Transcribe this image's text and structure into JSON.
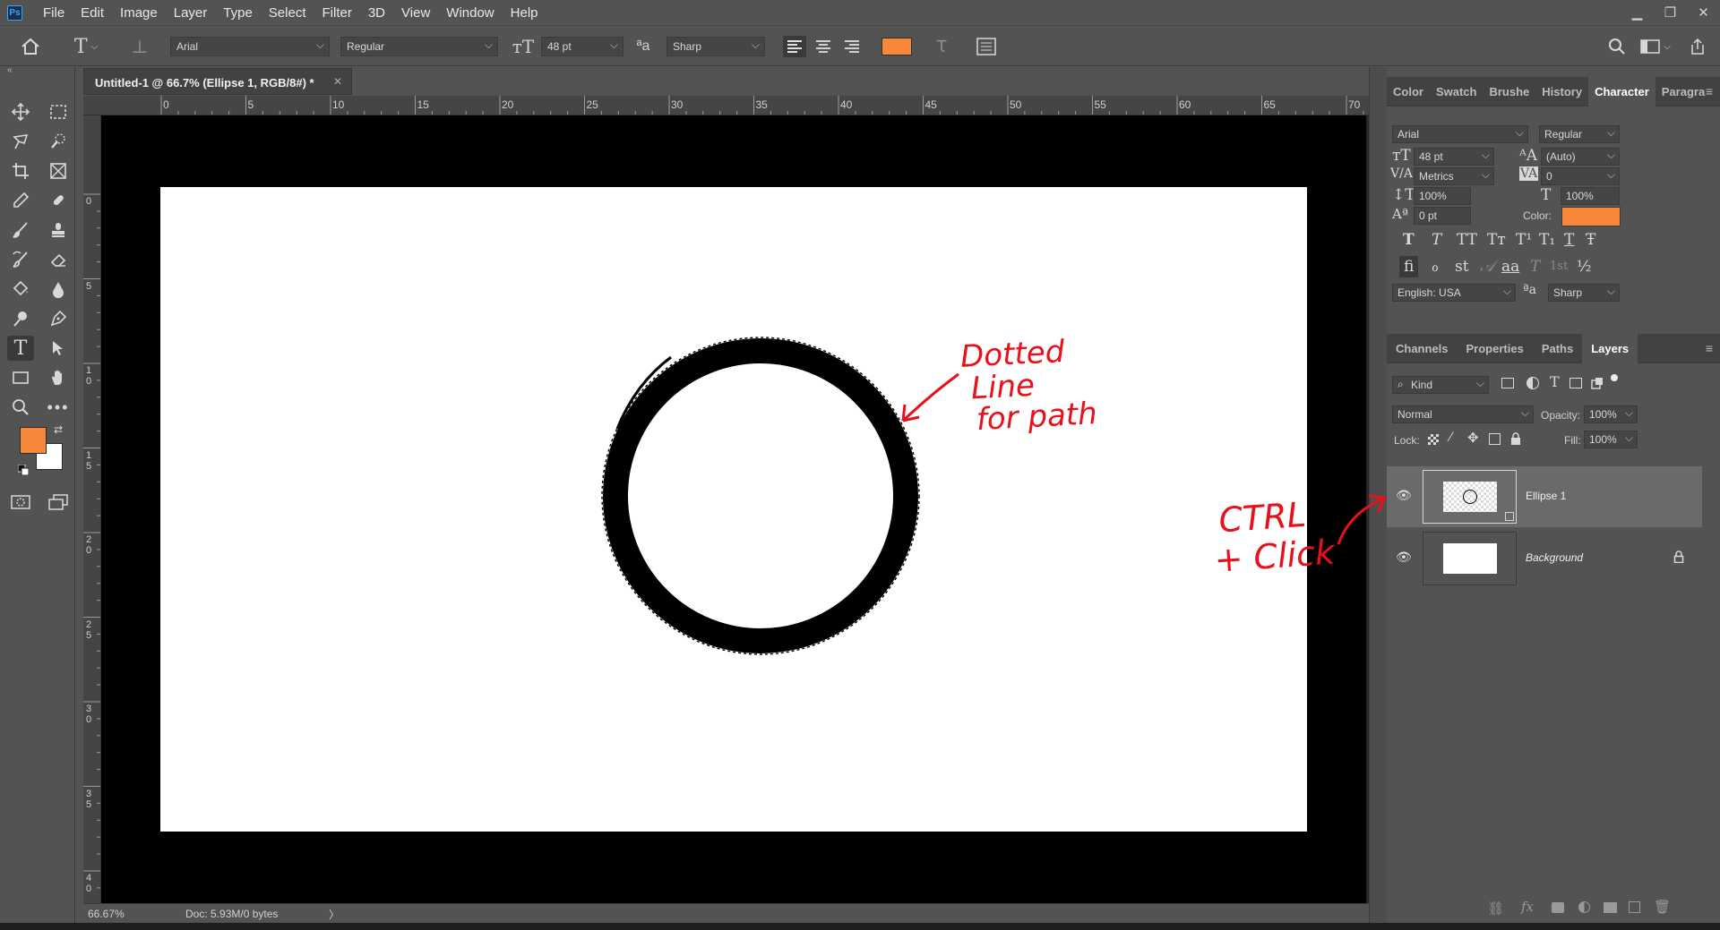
{
  "app": {
    "logo": "Ps"
  },
  "menu": [
    "File",
    "Edit",
    "Image",
    "Layer",
    "Type",
    "Select",
    "Filter",
    "3D",
    "View",
    "Window",
    "Help"
  ],
  "window_controls": {
    "minimize": "▁",
    "restore": "❐",
    "close": "✕"
  },
  "options": {
    "font_family": "Arial",
    "font_style": "Regular",
    "font_size": "48 pt",
    "aa_label": "ªa",
    "antialias": "Sharp",
    "color": "#f7883a"
  },
  "document_tab": {
    "title": "Untitled-1 @ 66.7% (Ellipse 1, RGB/8#) *",
    "close": "✕"
  },
  "ruler": {
    "h_labels": [
      "0",
      "5",
      "10",
      "15",
      "20",
      "25",
      "30",
      "35",
      "40",
      "45",
      "50",
      "55",
      "60",
      "65",
      "70"
    ],
    "v_labels": [
      "0",
      "5",
      "1\n0",
      "1\n5",
      "2\n0",
      "2\n5",
      "3\n0",
      "3\n5",
      "4\n0"
    ]
  },
  "status": {
    "zoom": "66.67%",
    "doc": "Doc: 5.93M/0 bytes",
    "arrow": "〉"
  },
  "char_panel": {
    "tabs": [
      "Color",
      "Swatch",
      "Brushe",
      "History",
      "Character",
      "Paragra"
    ],
    "active_tab": "Character",
    "font_family": "Arial",
    "font_style": "Regular",
    "size": "48 pt",
    "leading": "(Auto)",
    "kerning": "Metrics",
    "tracking": "0",
    "vscale": "100%",
    "hscale": "100%",
    "baseline": "0 pt",
    "color_label": "Color:",
    "color": "#f7883a",
    "language": "English: USA",
    "aa_label": "ªa",
    "antialias": "Sharp",
    "style_buttons": [
      "T",
      "T",
      "TT",
      "Tт",
      "T¹",
      "T₁",
      "T",
      "Ŧ"
    ],
    "opentype_buttons": [
      "ﬁ",
      "ℴ",
      "st",
      "𝒜",
      "aa",
      "T",
      "1st",
      "½"
    ]
  },
  "layers_panel": {
    "tabs": [
      "Channels",
      "Properties",
      "Paths",
      "Layers"
    ],
    "active_tab": "Layers",
    "kind": "Kind",
    "blend_mode": "Normal",
    "opacity_label": "Opacity:",
    "opacity": "100%",
    "lock_label": "Lock:",
    "fill_label": "Fill:",
    "fill": "100%",
    "layers": [
      {
        "name": "Ellipse 1",
        "selected": true
      },
      {
        "name": "Background",
        "selected": false
      }
    ],
    "footer_fx": "fx"
  },
  "annotations": {
    "dotted_line": [
      "Dotted",
      "Line",
      "for path"
    ],
    "ctrl_click": [
      "CTRL",
      "+ Click"
    ]
  }
}
